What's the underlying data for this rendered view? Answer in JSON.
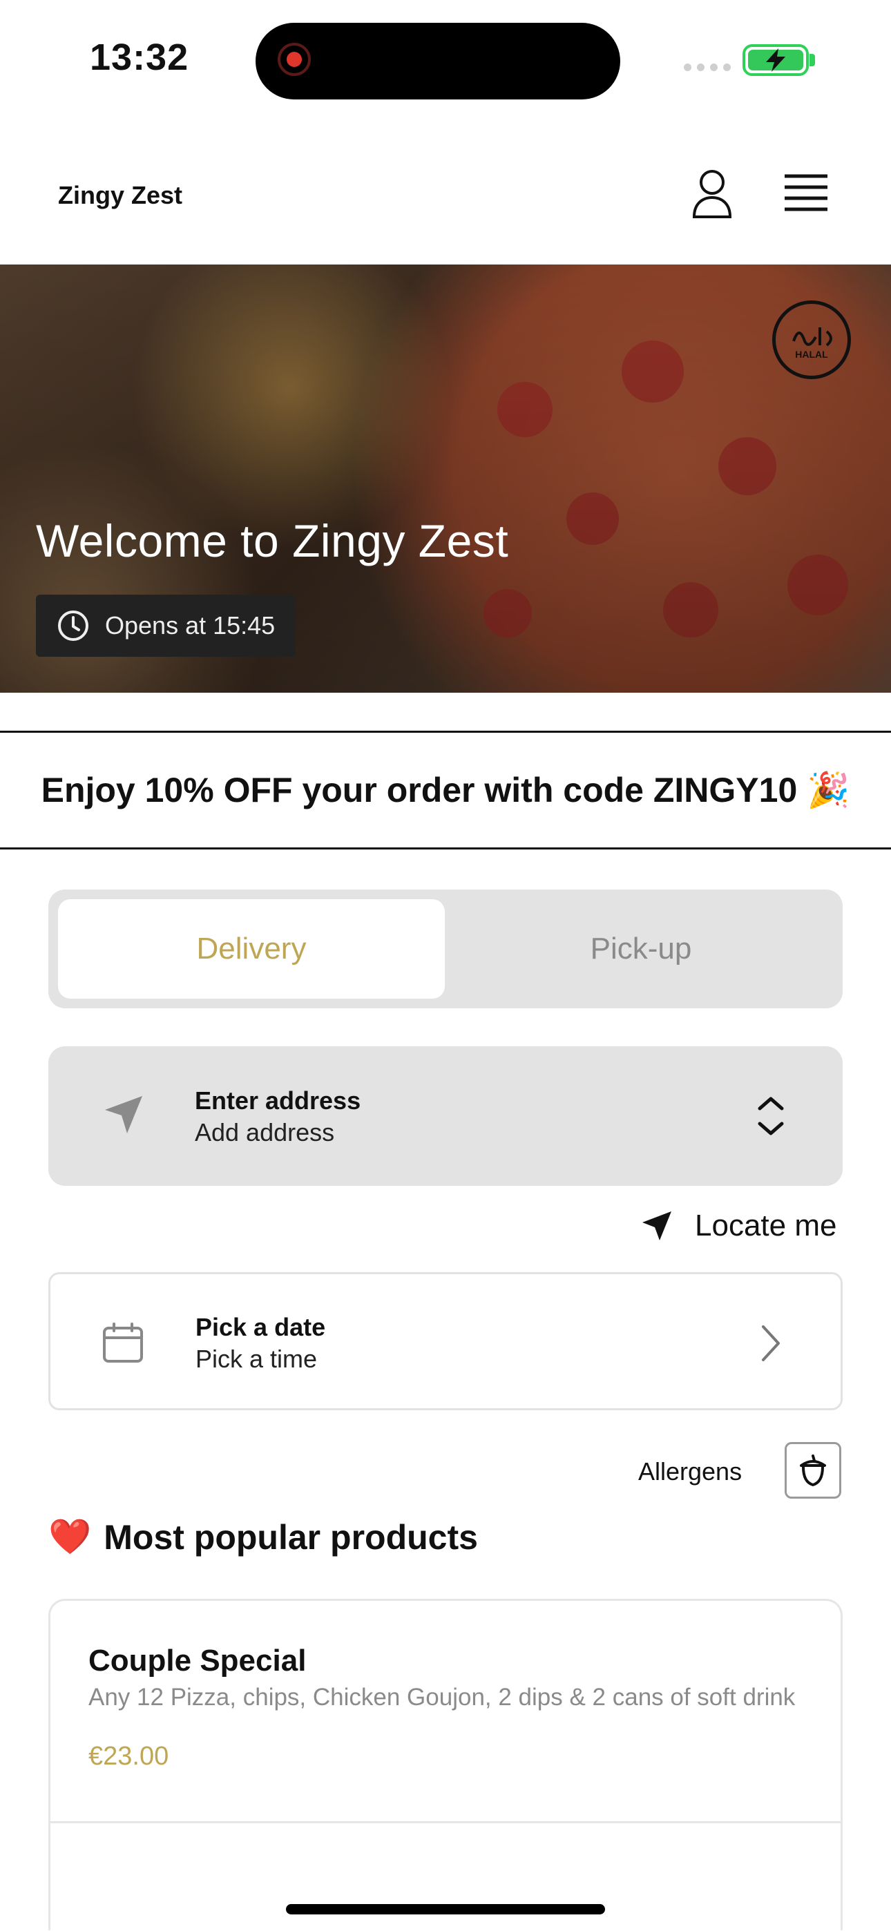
{
  "status_bar": {
    "time": "13:32"
  },
  "header": {
    "brand": "Zingy Zest"
  },
  "hero": {
    "title": "Welcome to Zingy Zest",
    "opening": "Opens at 15:45",
    "halal_badge_text": "HALAL"
  },
  "promo": {
    "text": "Enjoy 10% OFF your order with code ZINGY10 🎉"
  },
  "order_mode": {
    "tabs": [
      "Delivery",
      "Pick-up"
    ],
    "selected": "Delivery"
  },
  "address": {
    "title": "Enter address",
    "subtitle": "Add address"
  },
  "locate": {
    "label": "Locate me"
  },
  "schedule": {
    "title": "Pick a date",
    "subtitle": "Pick a time"
  },
  "allergens": {
    "label": "Allergens"
  },
  "popular": {
    "emoji": "❤️",
    "title": "Most popular products",
    "products": [
      {
        "name": "Couple Special",
        "description": "Any 12 Pizza, chips, Chicken Goujon, 2 dips & 2 cans of soft drink",
        "price": "€23.00"
      }
    ]
  },
  "colors": {
    "accent": "#bfa654",
    "panel": "#e3e3e3",
    "battery": "#34c759"
  }
}
